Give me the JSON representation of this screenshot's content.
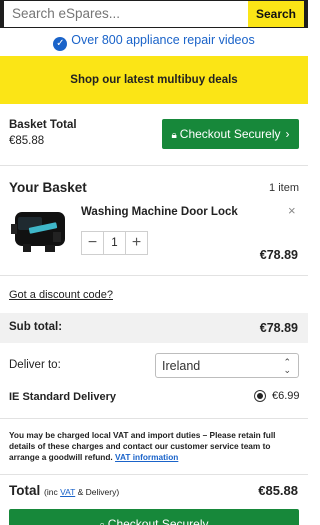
{
  "header": {
    "search_placeholder": "Search eSpares...",
    "search_button": "Search"
  },
  "promo": {
    "icon": "check-circle-icon",
    "text": "Over 800 appliance repair videos"
  },
  "multibuy_banner": "Shop our latest multibuy deals",
  "summary": {
    "basket_total_label": "Basket Total",
    "basket_total_value": "€85.88",
    "checkout_label": "Checkout Securely",
    "checkout_icon": "lock-icon",
    "checkout_arrow": "›"
  },
  "basket": {
    "title": "Your Basket",
    "item_count": "1 item",
    "items": [
      {
        "name": "Washing Machine Door Lock",
        "quantity": "1",
        "price": "€78.89",
        "remove_symbol": "×",
        "minus_symbol": "−",
        "plus_symbol": "+"
      }
    ]
  },
  "discount_link": "Got a discount code?",
  "subtotal": {
    "label": "Sub total:",
    "value": "€78.89"
  },
  "delivery": {
    "label": "Deliver to:",
    "country": "Ireland",
    "method": "IE Standard Delivery",
    "method_price": "€6.99",
    "selected": true
  },
  "vat_notice": {
    "text": "You may be charged local VAT and import duties – Please retain full details of these charges and contact our customer service team to arrange a goodwill refund.",
    "link": "VAT information"
  },
  "total": {
    "label": "Total",
    "sub_prefix": "(inc",
    "sub_link": "VAT",
    "sub_suffix": "& Delivery)",
    "value": "€85.88"
  },
  "checkout_bottom_label": "Checkout Securely",
  "colors": {
    "accent_yellow": "#fbe516",
    "checkout_green": "#17883a",
    "link_blue": "#1a63c9",
    "topbar_dark": "#1e1e1e"
  }
}
